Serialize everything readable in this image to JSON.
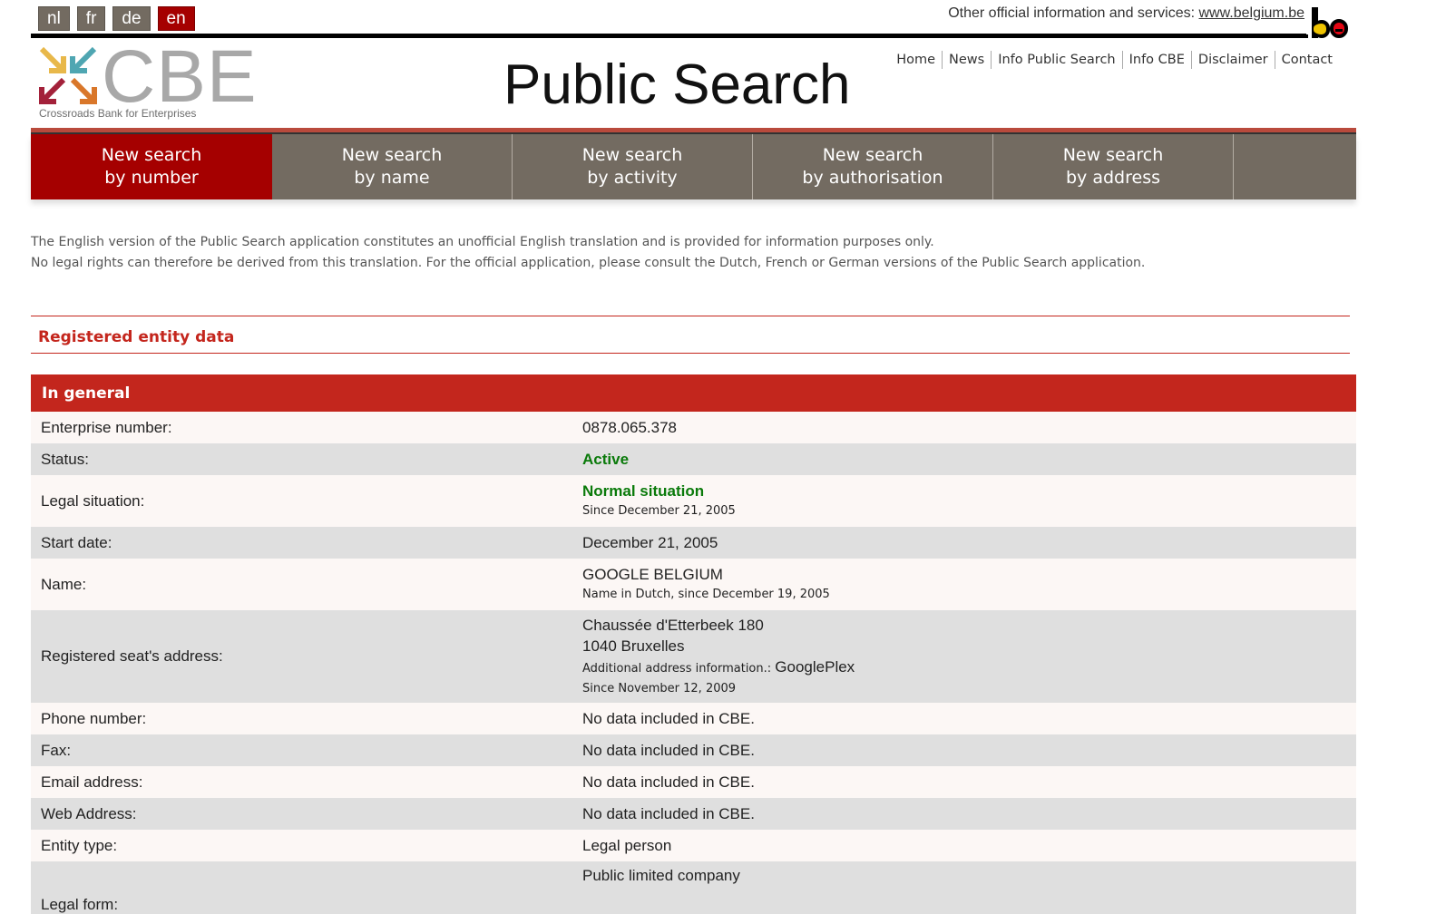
{
  "languages": [
    {
      "code": "nl",
      "active": false
    },
    {
      "code": "fr",
      "active": false
    },
    {
      "code": "de",
      "active": false
    },
    {
      "code": "en",
      "active": true
    }
  ],
  "other_info": {
    "text": "Other official information and services: ",
    "link": "www.belgium.be"
  },
  "be_logo": {
    "text": ".be",
    "colors": {
      "yellow": "#f0c400",
      "red": "#e30613",
      "black": "#000000"
    }
  },
  "logo": {
    "letters": "CBE",
    "tagline": "Crossroads Bank for Enterprises",
    "arrow_colors": [
      "#e8b84a",
      "#4fa6b2",
      "#a3213a",
      "#d9772a"
    ]
  },
  "page_title": "Public Search",
  "top_nav": [
    "Home",
    "News",
    "Info Public Search",
    "Info CBE",
    "Disclaimer",
    "Contact"
  ],
  "search_tabs": [
    {
      "line1": "New search",
      "line2": "by number",
      "active": true
    },
    {
      "line1": "New search",
      "line2": "by name",
      "active": false
    },
    {
      "line1": "New search",
      "line2": "by activity",
      "active": false
    },
    {
      "line1": "New search",
      "line2": "by authorisation",
      "active": false
    },
    {
      "line1": "New search",
      "line2": "by address",
      "active": false
    }
  ],
  "disclaimer": {
    "line1": "The English version of the Public Search application constitutes an unofficial English translation and is provided for information purposes only.",
    "line2": "No legal rights can therefore be derived from this translation. For the official application, please consult the Dutch, French or German versions of the Public Search application."
  },
  "section_title": "Registered entity data",
  "colors": {
    "accent_red": "#c3261d",
    "tab_active": "#a50000",
    "tab_inactive": "#736b61",
    "status_green": "#0a7a0a"
  },
  "general": {
    "heading": "In general",
    "enterprise_number": {
      "label": "Enterprise number:",
      "value": "0878.065.378"
    },
    "status": {
      "label": "Status:",
      "value": "Active"
    },
    "legal_situation": {
      "label": "Legal situation:",
      "value": "Normal situation",
      "since": "Since December 21, 2005"
    },
    "start_date": {
      "label": "Start date:",
      "value": "December 21, 2005"
    },
    "name": {
      "label": "Name:",
      "value": "GOOGLE BELGIUM",
      "note": "Name in Dutch, since December 19, 2005"
    },
    "address": {
      "label": "Registered seat's address:",
      "street": "Chaussée d'Etterbeek 180",
      "city": "1040 Bruxelles",
      "additional_label": "Additional address information.: ",
      "additional_value": "GooglePlex",
      "since": "Since November 12, 2009"
    },
    "phone": {
      "label": "Phone number:",
      "value": "No data included in CBE."
    },
    "fax": {
      "label": "Fax:",
      "value": "No data included in CBE."
    },
    "email": {
      "label": "Email address:",
      "value": "No data included in CBE."
    },
    "web": {
      "label": "Web Address:",
      "value": "No data included in CBE."
    },
    "entity_type": {
      "label": "Entity type:",
      "value": "Legal person"
    },
    "legal_form": {
      "label": "Legal form:",
      "value": "Public limited company"
    }
  }
}
